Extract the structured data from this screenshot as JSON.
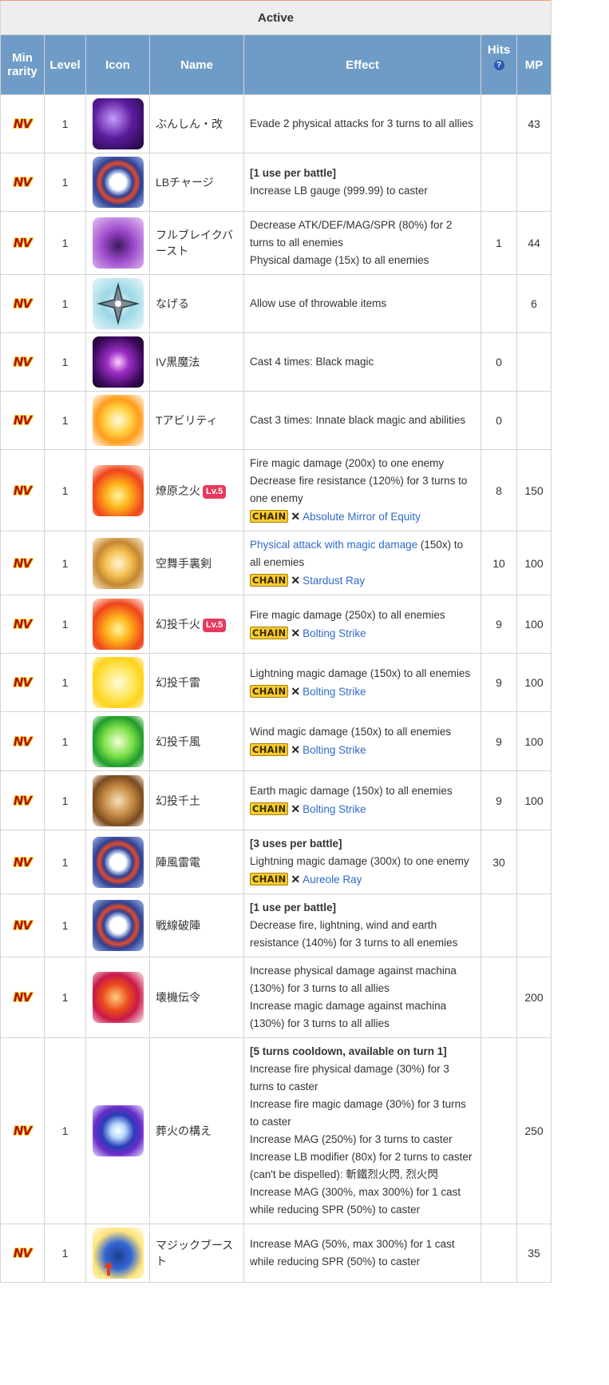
{
  "table": {
    "caption": "Active",
    "headers": {
      "min_rarity": "Min rarity",
      "level": "Level",
      "icon": "Icon",
      "name": "Name",
      "effect": "Effect",
      "hits": "Hits",
      "hits_help": "?",
      "mp": "MP"
    },
    "rarity_badge": "NV",
    "chain_badge": "CHAIN",
    "chain_sep": "✕",
    "lv_badge": "Lv.5",
    "rows": [
      {
        "level": "1",
        "name": "ぶんしん・改",
        "effect": [
          "Evade 2 physical attacks for 3 turns to all allies"
        ],
        "hits": "",
        "mp": "43",
        "icon": "dark-shield-icon"
      },
      {
        "level": "1",
        "name": "LBチャージ",
        "bold": "[1 use per battle]",
        "effect": [
          "Increase LB gauge (999.99) to caster"
        ],
        "hits": "",
        "mp": "",
        "icon": "lb-gauge-icon"
      },
      {
        "level": "1",
        "name": "フルブレイクバースト",
        "effect": [
          "Decrease ATK/DEF/MAG/SPR (80%) for 2 turns to all enemies",
          "Physical damage (15x) to all enemies"
        ],
        "hits": "1",
        "mp": "44",
        "icon": "purple-crystal-icon"
      },
      {
        "level": "1",
        "name": "なげる",
        "effect": [
          "Allow use of throwable items"
        ],
        "hits": "",
        "mp": "6",
        "icon": "shuriken-icon"
      },
      {
        "level": "1",
        "name": "IV黒魔法",
        "effect": [
          "Cast 4 times: Black magic"
        ],
        "hits": "0",
        "mp": "",
        "icon": "black-orb-icon"
      },
      {
        "level": "1",
        "name": "Tアビリティ",
        "effect": [
          "Cast 3 times: Innate black magic and abilities"
        ],
        "hits": "0",
        "mp": "",
        "icon": "burst-icon"
      },
      {
        "level": "1",
        "name": "燎原之火",
        "lv": true,
        "effect": [
          "Fire magic damage (200x) to one enemy",
          "Decrease fire resistance (120%) for 3 turns to one enemy"
        ],
        "chain": "Absolute Mirror of Equity",
        "hits": "8",
        "mp": "150",
        "icon": "fire-icon"
      },
      {
        "level": "1",
        "name": "空舞手裏剣",
        "link_effect": "Physical attack with magic damage",
        "effect_after_link": " (150x) to all enemies",
        "chain": "Stardust Ray",
        "hits": "10",
        "mp": "100",
        "icon": "explosion-icon"
      },
      {
        "level": "1",
        "name": "幻投千火",
        "lv": true,
        "effect": [
          "Fire magic damage (250x) to all enemies"
        ],
        "chain": "Bolting Strike",
        "hits": "9",
        "mp": "100",
        "icon": "fire-icon"
      },
      {
        "level": "1",
        "name": "幻投千雷",
        "effect": [
          "Lightning magic damage (150x) to all enemies"
        ],
        "chain": "Bolting Strike",
        "hits": "9",
        "mp": "100",
        "icon": "thunder-icon"
      },
      {
        "level": "1",
        "name": "幻投千風",
        "effect": [
          "Wind magic damage (150x) to all enemies"
        ],
        "chain": "Bolting Strike",
        "hits": "9",
        "mp": "100",
        "icon": "wind-icon"
      },
      {
        "level": "1",
        "name": "幻投千土",
        "effect": [
          "Earth magic damage (150x) to all enemies"
        ],
        "chain": "Bolting Strike",
        "hits": "9",
        "mp": "100",
        "icon": "earth-icon"
      },
      {
        "level": "1",
        "name": "陣風雷電",
        "bold": "[3 uses per battle]",
        "effect": [
          "Lightning magic damage (300x) to one enemy"
        ],
        "chain": "Aureole Ray",
        "hits": "30",
        "mp": "",
        "icon": "lb-gauge-icon"
      },
      {
        "level": "1",
        "name": "戦線破陣",
        "bold": "[1 use per battle]",
        "effect": [
          "Decrease fire, lightning, wind and earth resistance (140%) for 3 turns to all enemies"
        ],
        "hits": "",
        "mp": "",
        "icon": "lb-gauge-icon"
      },
      {
        "level": "1",
        "name": "壊機伝令",
        "effect": [
          "Increase physical damage against machina (130%) for 3 turns to all allies",
          "Increase magic damage against machina (130%) for 3 turns to all allies"
        ],
        "hits": "",
        "mp": "200",
        "icon": "red-slash-icon"
      },
      {
        "level": "1",
        "name": "葬火の構え",
        "bold": "[5 turns cooldown, available on turn 1]",
        "effect": [
          "Increase fire physical damage (30%) for 3 turns to caster",
          "Increase fire magic damage (30%) for 3 turns to caster",
          "Increase MAG (250%) for 3 turns to caster",
          "Increase LB modifier (80x) for 2 turns to caster (can't be dispelled): 斬鐵烈火閃, 烈火閃",
          "Increase MAG (300%, max 300%) for 1 cast while reducing SPR (50%) to caster"
        ],
        "hits": "",
        "mp": "250",
        "icon": "portal-icon"
      },
      {
        "level": "1",
        "name": "マジックブースト",
        "effect": [
          "Increase MAG (50%, max 300%) for 1 cast while reducing SPR (50%) to caster"
        ],
        "hits": "",
        "mp": "35",
        "icon": "magic-boost-icon"
      }
    ]
  }
}
